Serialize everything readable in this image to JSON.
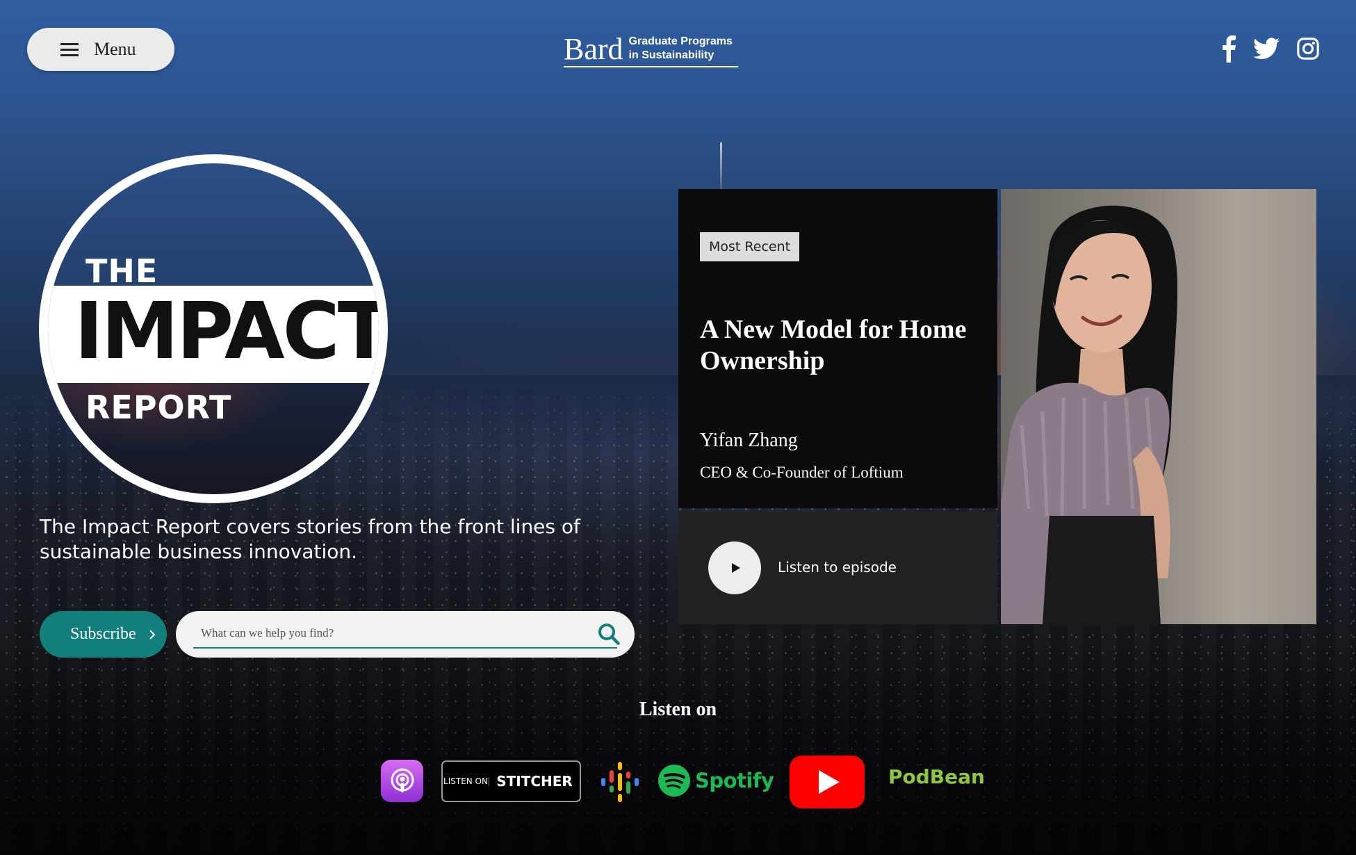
{
  "header": {
    "menu_label": "Menu",
    "brand_name": "Bard",
    "brand_sub_line1": "Graduate Programs",
    "brand_sub_line2": "in Sustainability",
    "social_icons": [
      "facebook-icon",
      "twitter-icon",
      "instagram-icon"
    ]
  },
  "podcast_logo": {
    "word_the": "THE",
    "word_impact": "IMPACT",
    "word_report": "REPORT"
  },
  "hero": {
    "tagline": "The Impact Report covers stories from the front lines of sustainable business innovation.",
    "subscribe_label": "Subscribe",
    "search_placeholder": "What can we help you find?"
  },
  "most_recent": {
    "badge": "Most Recent",
    "episode_title": "A New Model for Home Ownership",
    "guest_name": "Yifan Zhang",
    "guest_role": "CEO & Co-Founder of Loftium",
    "listen_label": "Listen to episode"
  },
  "listen_on": {
    "heading": "Listen on",
    "stitcher_listen": "LISTEN ON",
    "stitcher_word": "STITCHER",
    "spotify_word": "Spotify",
    "podbean_word": "PodBean"
  },
  "colors": {
    "accent_teal": "#127f7c",
    "spotify_green": "#1db954",
    "youtube_red": "#ff0000",
    "podbean_green": "#8dc63f"
  }
}
